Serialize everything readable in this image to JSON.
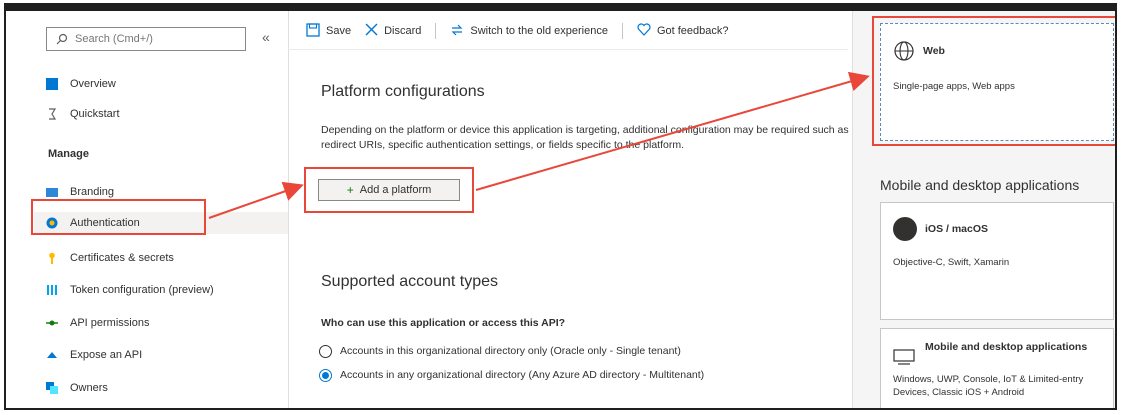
{
  "sidebar": {
    "search_placeholder": "Search (Cmd+/)",
    "collapse_glyph": "«",
    "items": [
      {
        "label": "Overview",
        "icon": "overview-icon"
      },
      {
        "label": "Quickstart",
        "icon": "quickstart-icon"
      }
    ],
    "manage_title": "Manage",
    "manage_items": [
      {
        "label": "Branding",
        "icon": "branding-icon"
      },
      {
        "label": "Authentication",
        "icon": "authentication-icon"
      },
      {
        "label": "Certificates & secrets",
        "icon": "key-icon"
      },
      {
        "label": "Token configuration (preview)",
        "icon": "token-icon"
      },
      {
        "label": "API permissions",
        "icon": "api-permissions-icon"
      },
      {
        "label": "Expose an API",
        "icon": "cloud-icon"
      },
      {
        "label": "Owners",
        "icon": "owners-icon"
      }
    ]
  },
  "toolbar": {
    "save": "Save",
    "discard": "Discard",
    "switch": "Switch to the old experience",
    "feedback": "Got feedback?"
  },
  "main": {
    "platform_title": "Platform configurations",
    "platform_desc": "Depending on the platform or device this application is targeting, additional configuration may be required such as redirect URIs, specific authentication settings, or fields specific to the platform.",
    "add_platform": "Add a platform",
    "account_title": "Supported account types",
    "account_question": "Who can use this application or access this API?",
    "radio_single": "Accounts in this organizational directory only (Oracle only - Single tenant)",
    "radio_multi": "Accounts in any organizational directory (Any Azure AD directory - Multitenant)"
  },
  "right_panel": {
    "web_title": "Web",
    "web_sub": "Single-page apps, Web apps",
    "mobile_heading": "Mobile and desktop applications",
    "ios_title": "iOS / macOS",
    "ios_sub": "Objective-C, Swift, Xamarin",
    "desktop_title": "Mobile and desktop applications",
    "desktop_sub": "Windows, UWP, Console, IoT & Limited-entry Devices, Classic iOS + Android"
  },
  "colors": {
    "highlight": "#e8473a",
    "accent": "#0078d4"
  }
}
